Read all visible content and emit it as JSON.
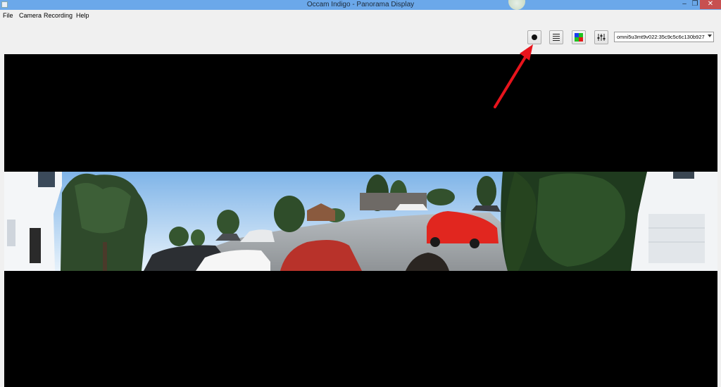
{
  "window": {
    "title": "Occam Indigo - Panorama Display",
    "minimize": "–",
    "maximize": "❐",
    "close": "✕"
  },
  "menu": {
    "items": [
      {
        "label": "File"
      },
      {
        "label": "Camera"
      },
      {
        "label": "Recording"
      },
      {
        "label": "Help"
      }
    ]
  },
  "toolbar": {
    "record_icon": "record-dot-icon",
    "list_icon": "list-lines-icon",
    "color_icon": "color-grid-icon",
    "adjust_icon": "sliders-icon",
    "device_select": {
      "value": "omni5u3mt9v022:35c9c5c6c130b927"
    }
  },
  "colors": {
    "titlebar": "#6ba8ea",
    "annotation_arrow": "#e8141c"
  }
}
